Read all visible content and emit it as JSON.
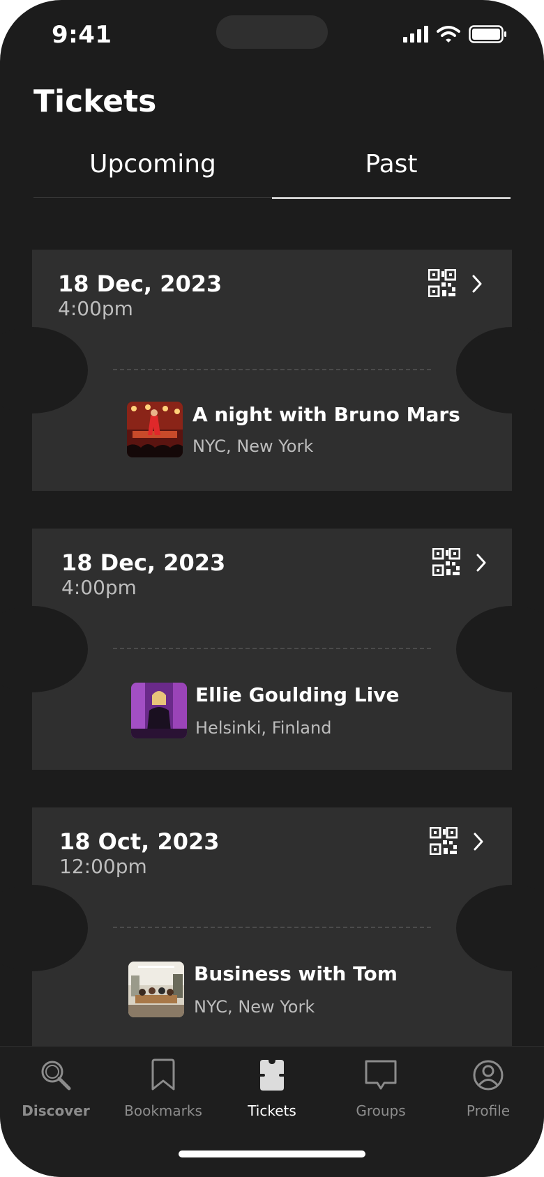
{
  "status_bar": {
    "time": "9:41"
  },
  "page": {
    "title": "Tickets"
  },
  "tabs": [
    {
      "label": "Upcoming",
      "selected": false
    },
    {
      "label": "Past",
      "selected": true
    }
  ],
  "tickets": [
    {
      "date": "18 Dec, 2023",
      "time": "4:00pm",
      "event": "A night with Bruno Mars",
      "location": "NYC, New York"
    },
    {
      "date": "18 Dec, 2023",
      "time": "4:00pm",
      "event": "Ellie Goulding Live",
      "location": "Helsinki, Finland"
    },
    {
      "date": "18 Oct, 2023",
      "time": "12:00pm",
      "event": "Business with Tom",
      "location": "NYC, New York"
    }
  ],
  "nav": [
    {
      "label": "Discover",
      "icon": "search-icon"
    },
    {
      "label": "Bookmarks",
      "icon": "bookmark-icon"
    },
    {
      "label": "Tickets",
      "icon": "ticket-icon",
      "active": true
    },
    {
      "label": "Groups",
      "icon": "chat-bubble-icon"
    },
    {
      "label": "Profile",
      "icon": "user-circle-icon"
    }
  ],
  "colors": {
    "background": "#1c1c1c",
    "card": "#2f2f2f",
    "text": "#ffffff",
    "muted": "#bdbdbd"
  }
}
